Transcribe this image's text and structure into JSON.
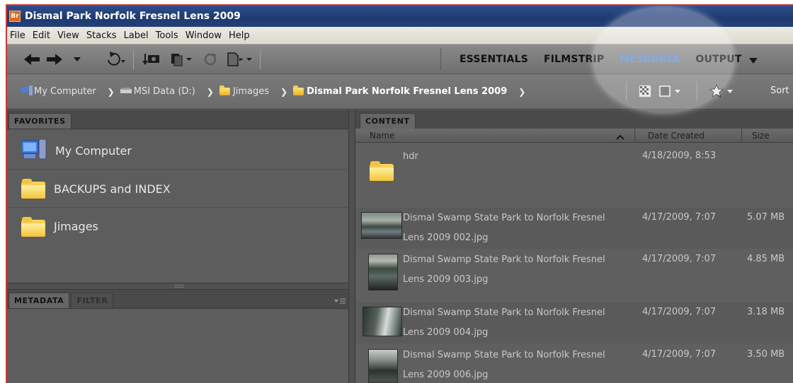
{
  "window": {
    "title": "Dismal Park Norfolk Fresnel Lens 2009",
    "app_badge": "Br"
  },
  "menu": [
    "File",
    "Edit",
    "View",
    "Stacks",
    "Label",
    "Tools",
    "Window",
    "Help"
  ],
  "toolbar": {
    "workspaces": [
      {
        "label": "ESSENTIALS",
        "active": false
      },
      {
        "label": "FILMSTRIP",
        "active": false
      },
      {
        "label": "METADATA",
        "active": true
      },
      {
        "label": "OUTPUT",
        "active": false
      }
    ],
    "icons": [
      "back-arrow-icon",
      "forward-arrow-icon",
      "recent-dropdown-icon",
      "return-to-app-icon",
      "get-photos-icon",
      "refine-icon",
      "rotate-icon",
      "open-in-camera-raw-icon"
    ]
  },
  "path": {
    "crumbs": [
      "My Computer",
      "MSI Data (D:)",
      "Jimages",
      "Dismal Park Norfolk Fresnel Lens 2009"
    ],
    "sort_label": "Sort"
  },
  "left": {
    "tabs_top": [
      "FAVORITES"
    ],
    "favorites": [
      "My Computer",
      "BACKUPS and INDEX",
      "Jimages"
    ],
    "tabs_bottom": [
      "METADATA",
      "FILTER"
    ]
  },
  "content": {
    "tab": "CONTENT",
    "columns": {
      "name": "Name",
      "date": "Date Created",
      "size": "Size"
    },
    "rows": [
      {
        "name1": "hdr",
        "name2": "",
        "date": "4/18/2009, 8:53",
        "size": ""
      },
      {
        "name1": "Dismal Swamp State Park to Norfolk Fresnel",
        "name2": "Lens 2009 002.jpg",
        "date": "4/17/2009, 7:07",
        "size": "5.07 MB"
      },
      {
        "name1": "Dismal Swamp State Park to Norfolk Fresnel",
        "name2": "Lens 2009 003.jpg",
        "date": "4/17/2009, 7:07",
        "size": "4.85 MB"
      },
      {
        "name1": "Dismal Swamp State Park to Norfolk Fresnel",
        "name2": "Lens 2009 004.jpg",
        "date": "4/17/2009, 7:07",
        "size": "3.18 MB"
      },
      {
        "name1": "Dismal Swamp State Park to Norfolk Fresnel",
        "name2": "Lens 2009 006.jpg",
        "date": "4/17/2009, 7:07",
        "size": "3.50 MB"
      }
    ]
  },
  "colors": {
    "accent_workspace": "#4d8de6",
    "titlebar": "#1f3a6f",
    "panel_bg": "#5d5d5d"
  }
}
